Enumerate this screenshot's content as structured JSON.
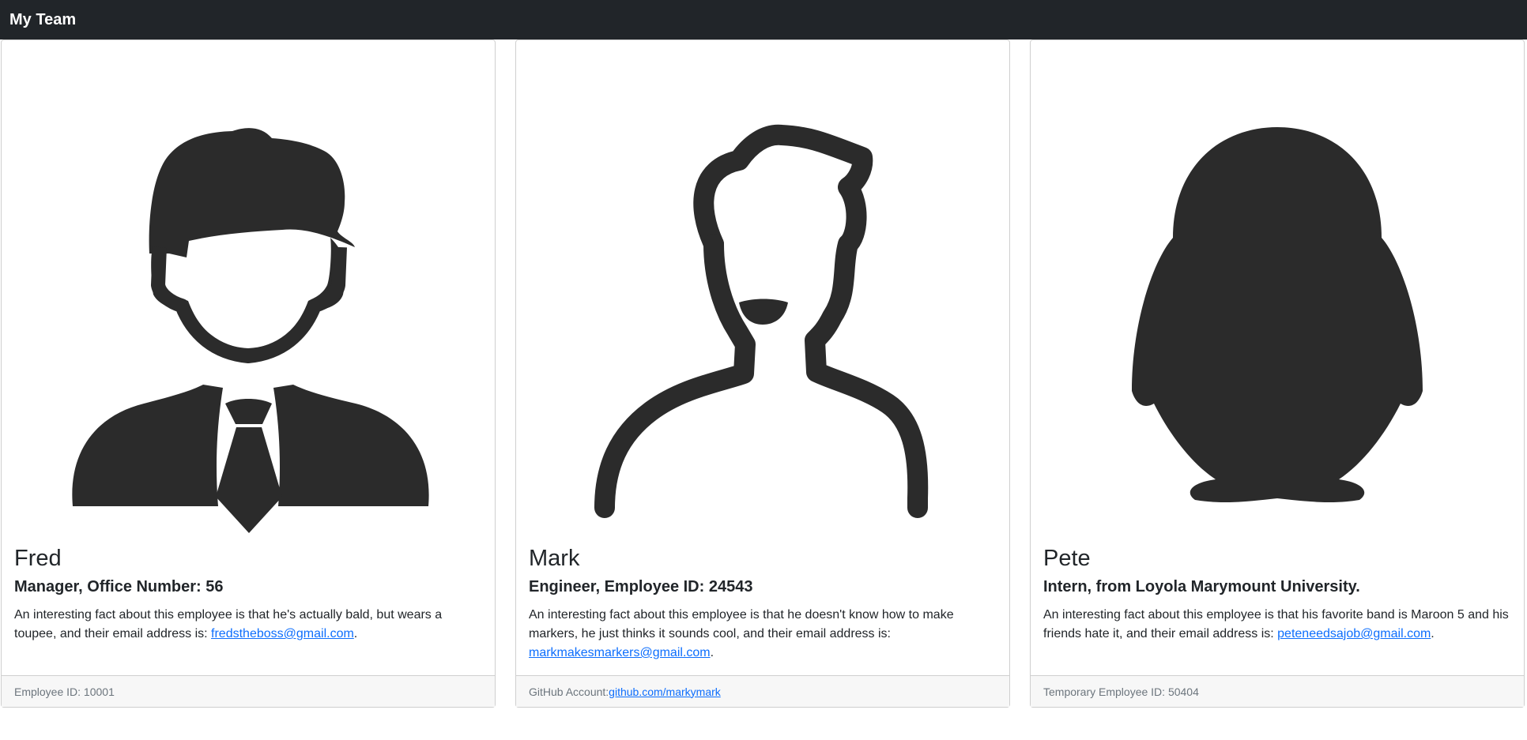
{
  "navbar": {
    "title": "My Team"
  },
  "colors": {
    "navbar_bg": "#212529",
    "icon": "#2b2b2b",
    "link": "#0d6efd"
  },
  "cards": [
    {
      "icon": "manager-icon",
      "name": "Fred",
      "role": "Manager, Office Number: 56",
      "fact_text": "An interesting fact about this employee is that he's actually bald, but wears a toupee, and their email address is: ",
      "email": "fredstheboss@gmail.com",
      "fact_end": ".",
      "footer_label": "Employee ID: 10001"
    },
    {
      "icon": "engineer-icon",
      "name": "Mark",
      "role": "Engineer, Employee ID: 24543",
      "fact_text": "An interesting fact about this employee is that he doesn't know how to make markers, he just thinks it sounds cool, and their email address is: ",
      "email": "markmakesmarkers@gmail.com",
      "fact_end": ".",
      "footer_label": "GitHub Account: ",
      "footer_link": "github.com/markymark"
    },
    {
      "icon": "penguin-icon",
      "name": "Pete",
      "role": "Intern, from Loyola Marymount University.",
      "fact_text": "An interesting fact about this employee is that his favorite band is Maroon 5 and his friends hate it, and their email address is: ",
      "email": "peteneedsajob@gmail.com",
      "fact_end": ".",
      "footer_label": "Temporary Employee ID: 50404"
    }
  ]
}
